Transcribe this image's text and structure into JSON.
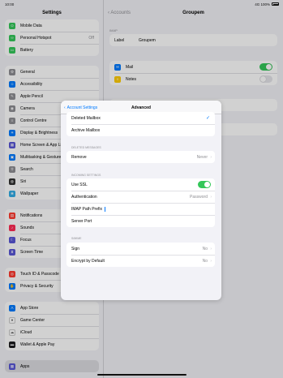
{
  "status": {
    "time": "10:00",
    "network": "4G 100%"
  },
  "sidebar": {
    "title": "Settings",
    "group1": [
      {
        "label": "Mobile Data",
        "icon": "antenna-icon",
        "color": "#34c759",
        "value": ""
      },
      {
        "label": "Personal Hotspot",
        "icon": "hotspot-icon",
        "color": "#34c759",
        "value": "Off"
      },
      {
        "label": "Battery",
        "icon": "battery-icon",
        "color": "#34c759",
        "value": ""
      }
    ],
    "group2": [
      {
        "label": "General",
        "icon": "gear-icon",
        "color": "#8e8e93"
      },
      {
        "label": "Accessibility",
        "icon": "accessibility-icon",
        "color": "#007aff"
      },
      {
        "label": "Apple Pencil",
        "icon": "pencil-icon",
        "color": "#8e8e93"
      },
      {
        "label": "Camera",
        "icon": "camera-icon",
        "color": "#8e8e93"
      },
      {
        "label": "Control Centre",
        "icon": "control-centre-icon",
        "color": "#8e8e93"
      },
      {
        "label": "Display & Brightness",
        "icon": "brightness-icon",
        "color": "#007aff"
      },
      {
        "label": "Home Screen & App Library",
        "icon": "home-screen-icon",
        "color": "#5856d6"
      },
      {
        "label": "Multitasking & Gestures",
        "icon": "multitasking-icon",
        "color": "#007aff"
      },
      {
        "label": "Search",
        "icon": "search-icon",
        "color": "#8e8e93"
      },
      {
        "label": "Siri",
        "icon": "siri-icon",
        "color": "#333333"
      },
      {
        "label": "Wallpaper",
        "icon": "wallpaper-icon",
        "color": "#32ade6"
      }
    ],
    "group3": [
      {
        "label": "Notifications",
        "icon": "notifications-icon",
        "color": "#ff3b30"
      },
      {
        "label": "Sounds",
        "icon": "sounds-icon",
        "color": "#ff2d55"
      },
      {
        "label": "Focus",
        "icon": "focus-icon",
        "color": "#5856d6"
      },
      {
        "label": "Screen Time",
        "icon": "screen-time-icon",
        "color": "#5856d6"
      }
    ],
    "group4": [
      {
        "label": "Touch ID & Passcode",
        "icon": "fingerprint-icon",
        "color": "#ff3b30"
      },
      {
        "label": "Privacy & Security",
        "icon": "privacy-icon",
        "color": "#007aff"
      }
    ],
    "group5": [
      {
        "label": "App Store",
        "icon": "app-store-icon",
        "color": "#007aff"
      },
      {
        "label": "Game Center",
        "icon": "game-center-icon",
        "color": "#ffffff"
      },
      {
        "label": "iCloud",
        "icon": "icloud-icon",
        "color": "#ffffff"
      },
      {
        "label": "Wallet & Apple Pay",
        "icon": "wallet-icon",
        "color": "#1c1c1e"
      }
    ],
    "group6": [
      {
        "label": "Apps",
        "icon": "apps-icon",
        "color": "#5856d6"
      }
    ]
  },
  "detail": {
    "back": "Accounts",
    "title": "Groupem",
    "section_imap": "IMAP",
    "label_key": "Label",
    "label_value": "Groupem",
    "mail": "Mail",
    "notes": "Notes"
  },
  "modal": {
    "back": "Account Settings",
    "title": "Advanced",
    "mailbox_rows": [
      "Deleted Mailbox",
      "Archive Mailbox"
    ],
    "section_deleted": "DELETED MESSAGES",
    "remove_label": "Remove",
    "remove_value": "Never",
    "section_incoming": "INCOMING SETTINGS",
    "use_ssl": "Use SSL",
    "authentication": "Authentication",
    "authentication_value": "Password",
    "imap_prefix": "IMAP Path Prefix",
    "server_port": "Server Port",
    "section_smime": "S/MIME",
    "sign": "Sign",
    "sign_value": "No",
    "encrypt": "Encrypt by Default",
    "encrypt_value": "No"
  }
}
